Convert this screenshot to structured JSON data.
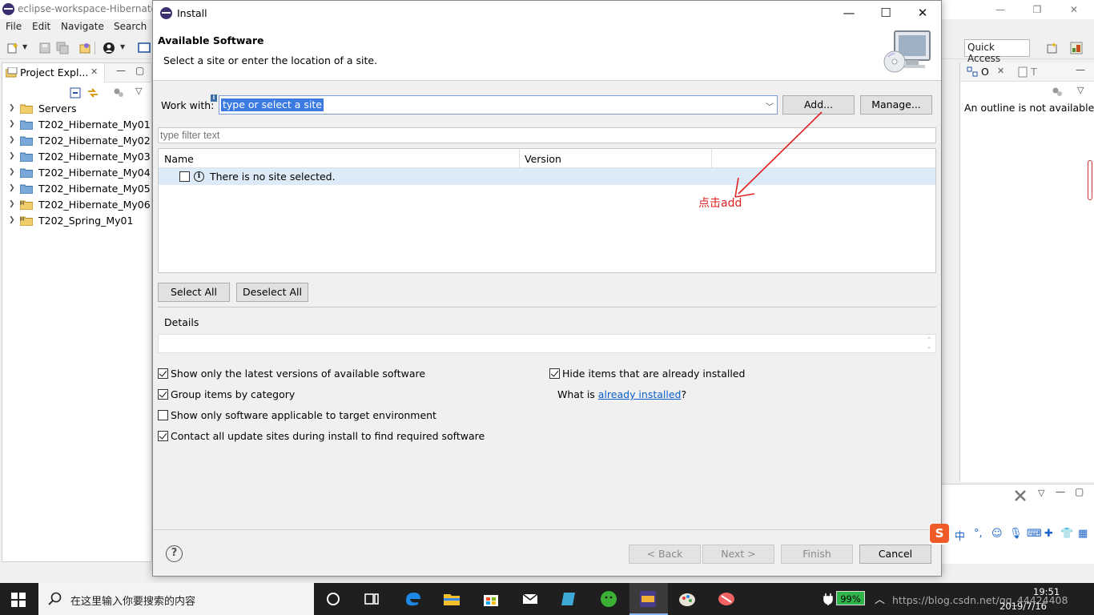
{
  "eclipse": {
    "window_title": "eclipse-workspace-Hibernate",
    "menu": [
      "File",
      "Edit",
      "Navigate",
      "Search"
    ],
    "quick_access": "Quick Access",
    "project_explorer": {
      "tab_label": "Project Expl...",
      "items": [
        {
          "label": "Servers",
          "icon": "folder-icon"
        },
        {
          "label": "T202_Hibernate_My01",
          "icon": "project-icon"
        },
        {
          "label": "T202_Hibernate_My02",
          "icon": "project-icon"
        },
        {
          "label": "T202_Hibernate_My03",
          "icon": "project-icon"
        },
        {
          "label": "T202_Hibernate_My04",
          "icon": "project-icon"
        },
        {
          "label": "T202_Hibernate_My05",
          "icon": "project-icon"
        },
        {
          "label": "T202_Hibernate_My06",
          "icon": "maven-project-icon"
        },
        {
          "label": "T202_Spring_My01",
          "icon": "maven-project-icon"
        }
      ]
    },
    "outline": {
      "tab_label": "O",
      "tab2_label": "T",
      "message": "An outline is not available."
    }
  },
  "dialog": {
    "title": "Install",
    "heading": "Available Software",
    "subheading": "Select a site or enter the location of a site.",
    "work_with_label": "Work with:",
    "work_with_value": "type or select a site",
    "add_button": "Add...",
    "manage_button": "Manage...",
    "filter_placeholder": "type filter text",
    "table": {
      "columns": [
        "Name",
        "Version"
      ],
      "rows": [
        {
          "name": "There is no site selected."
        }
      ]
    },
    "select_all": "Select All",
    "deselect_all": "Deselect All",
    "details_label": "Details",
    "options": {
      "latest_versions": {
        "label": "Show only the latest versions of available software",
        "checked": true
      },
      "group_by_category": {
        "label": "Group items by category",
        "checked": true
      },
      "target_env": {
        "label": "Show only software applicable to target environment",
        "checked": false
      },
      "contact_sites": {
        "label": "Contact all update sites during install to find required software",
        "checked": true
      },
      "hide_installed": {
        "label": "Hide items that are already installed",
        "checked": true
      }
    },
    "what_is_prefix": "What is ",
    "already_installed_link": "already installed",
    "what_is_suffix": "?",
    "footer": {
      "back": "< Back",
      "next": "Next >",
      "finish": "Finish",
      "cancel": "Cancel"
    }
  },
  "annotation": {
    "text": "点击add",
    "color": "#e02020"
  },
  "taskbar": {
    "search_text": "在这里输入你要搜索的内容",
    "battery": "99%",
    "time": "19:51",
    "date": "2019/7/16",
    "url_overlay": "https://blog.csdn.net/qq_44424408"
  }
}
